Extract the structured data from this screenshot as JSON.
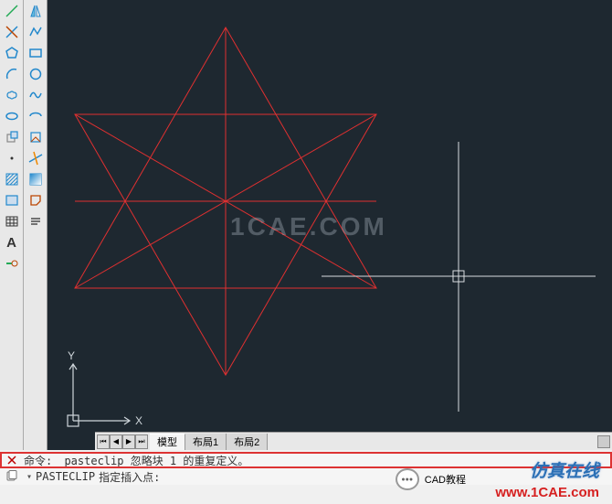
{
  "tabs": {
    "model": "模型",
    "layout1": "布局1",
    "layout2": "布局2"
  },
  "command": {
    "line1_label": "命令:",
    "line1_text": "_pasteclip 忽略块 1 的重复定义。",
    "line2_cmd": "PASTECLIP",
    "line2_prompt": "指定插入点:"
  },
  "ucs": {
    "x": "X",
    "y": "Y"
  },
  "watermark": {
    "center": "1CAE.COM",
    "tutorial": "CAD教程",
    "brand": "仿真在线",
    "url": "www.1CAE.com"
  },
  "icons": {
    "line": "line-icon",
    "polyline": "polyline-icon",
    "circle": "circle-icon",
    "arc": "arc-icon",
    "rect": "rect-icon",
    "ellipse": "ellipse-icon",
    "hatch": "hatch-icon",
    "point": "point-icon",
    "spline": "spline-icon",
    "ray": "ray-icon",
    "table": "table-icon",
    "text": "text-icon"
  }
}
